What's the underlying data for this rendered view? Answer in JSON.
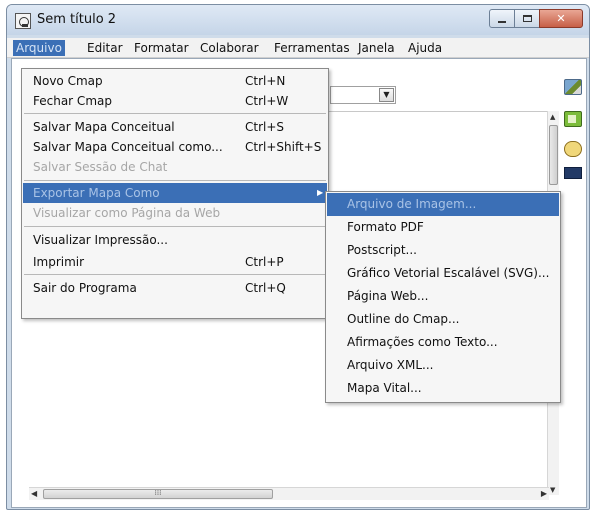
{
  "window": {
    "title": "Sem título 2"
  },
  "menubar": [
    "Arquivo",
    "Editar",
    "Formatar",
    "Colaborar",
    "Ferramentas",
    "Janela",
    "Ajuda"
  ],
  "file_menu": [
    {
      "label": "Novo Cmap",
      "shortcut": "Ctrl+N",
      "enabled": true
    },
    {
      "label": "Fechar Cmap",
      "shortcut": "Ctrl+W",
      "enabled": true
    },
    {
      "label": "Salvar Mapa Conceitual",
      "shortcut": "Ctrl+S",
      "enabled": true
    },
    {
      "label": "Salvar Mapa Conceitual como...",
      "shortcut": "Ctrl+Shift+S",
      "enabled": true
    },
    {
      "label": "Salvar Sessão de Chat",
      "shortcut": "",
      "enabled": false
    },
    {
      "label": "Exportar Mapa Como",
      "shortcut": "",
      "enabled": true,
      "highlighted": true,
      "submenu": true
    },
    {
      "label": "Visualizar como Página da Web",
      "shortcut": "",
      "enabled": false
    },
    {
      "label": "Visualizar Impressão...",
      "shortcut": "",
      "enabled": true
    },
    {
      "label": "Imprimir",
      "shortcut": "Ctrl+P",
      "enabled": true
    },
    {
      "label": "Sair do Programa",
      "shortcut": "Ctrl+Q",
      "enabled": true
    }
  ],
  "export_submenu": [
    {
      "label": "Arquivo de Imagem...",
      "highlighted": true
    },
    {
      "label": "Formato PDF"
    },
    {
      "label": "Postscript..."
    },
    {
      "label": "Gráfico Vetorial Escalável (SVG)..."
    },
    {
      "label": "Página Web..."
    },
    {
      "label": "Outline do Cmap..."
    },
    {
      "label": "Afirmações como Texto..."
    },
    {
      "label": "Arquivo XML..."
    },
    {
      "label": "Mapa Vital..."
    }
  ],
  "icons": {
    "app": "cmap-app-icon",
    "toolbar": [
      "pencil-edit-icon",
      "book-icon",
      "collaborators-icon",
      "presentation-icon"
    ],
    "combo_arrow": "chevron-down-icon"
  },
  "colors": {
    "highlight": "#3b6fb6",
    "disabled_text": "#a6a6a6",
    "close_button": "#c75f47"
  }
}
